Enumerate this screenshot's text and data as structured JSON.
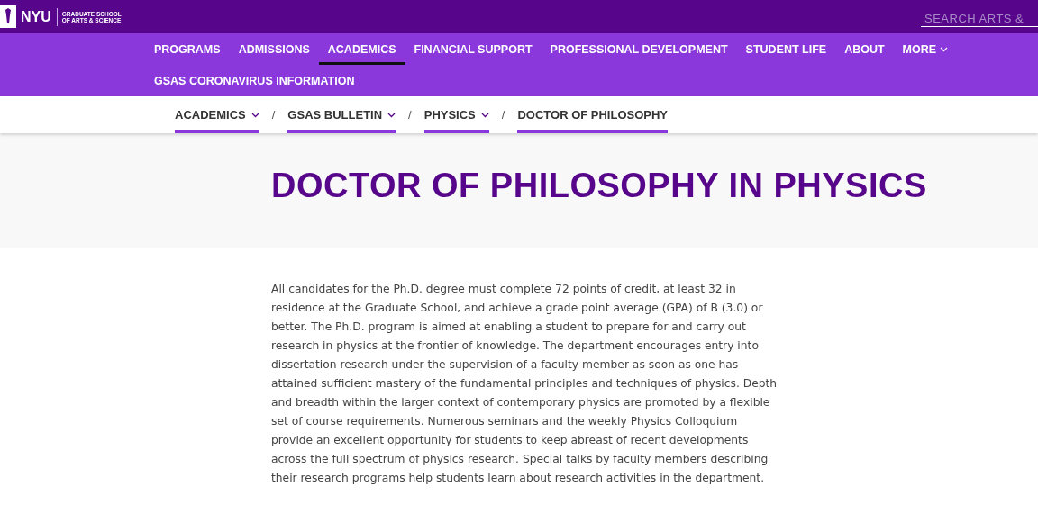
{
  "header": {
    "logo": "NYU",
    "school": [
      "GRADUATE SCHOOL",
      "OF ARTS & SCIENCE"
    ],
    "search": {
      "placeholder": "SEARCH ARTS &"
    }
  },
  "nav": [
    {
      "label": "PROGRAMS",
      "selected": false,
      "has_menu": false
    },
    {
      "label": "ADMISSIONS",
      "selected": false,
      "has_menu": false
    },
    {
      "label": "ACADEMICS",
      "selected": true,
      "has_menu": false
    },
    {
      "label": "FINANCIAL SUPPORT",
      "selected": false,
      "has_menu": false
    },
    {
      "label": "PROFESSIONAL DEVELOPMENT",
      "selected": false,
      "has_menu": false
    },
    {
      "label": "STUDENT LIFE",
      "selected": false,
      "has_menu": false
    },
    {
      "label": "ABOUT",
      "selected": false,
      "has_menu": false
    },
    {
      "label": "MORE",
      "selected": false,
      "has_menu": true
    },
    {
      "label": "GSAS CORONAVIRUS INFORMATION",
      "selected": false,
      "has_menu": false
    }
  ],
  "breadcrumb": [
    {
      "label": "ACADEMICS",
      "has_menu": true
    },
    {
      "label": "GSAS BULLETIN",
      "has_menu": true
    },
    {
      "label": "PHYSICS",
      "has_menu": true
    },
    {
      "label": "DOCTOR OF PHILOSOPHY",
      "has_menu": false
    }
  ],
  "separator": "/",
  "title": "DOCTOR OF PHILOSOPHY IN PHYSICS",
  "body": "All candidates for the Ph.D. degree must complete 72 points of credit, at least 32 in residence at the Graduate School, and achieve a grade point average (GPA) of B (3.0) or better. The Ph.D. program is aimed at enabling a student to prepare for and carry out research in physics at the frontier of knowledge. The department encourages entry into dissertation research under the supervision of a faculty member as soon as one has attained sufficient mastery of the fundamental principles and techniques of physics. Depth and breadth within the larger context of contemporary physics are promoted by a flexible set of course requirements. Numerous seminars and the weekly Physics Colloquium provide an excellent opportunity for students to keep abreast of recent developments across the full spectrum of physics research. Special talks by faculty members describing their research programs help students learn about research activities in the department."
}
